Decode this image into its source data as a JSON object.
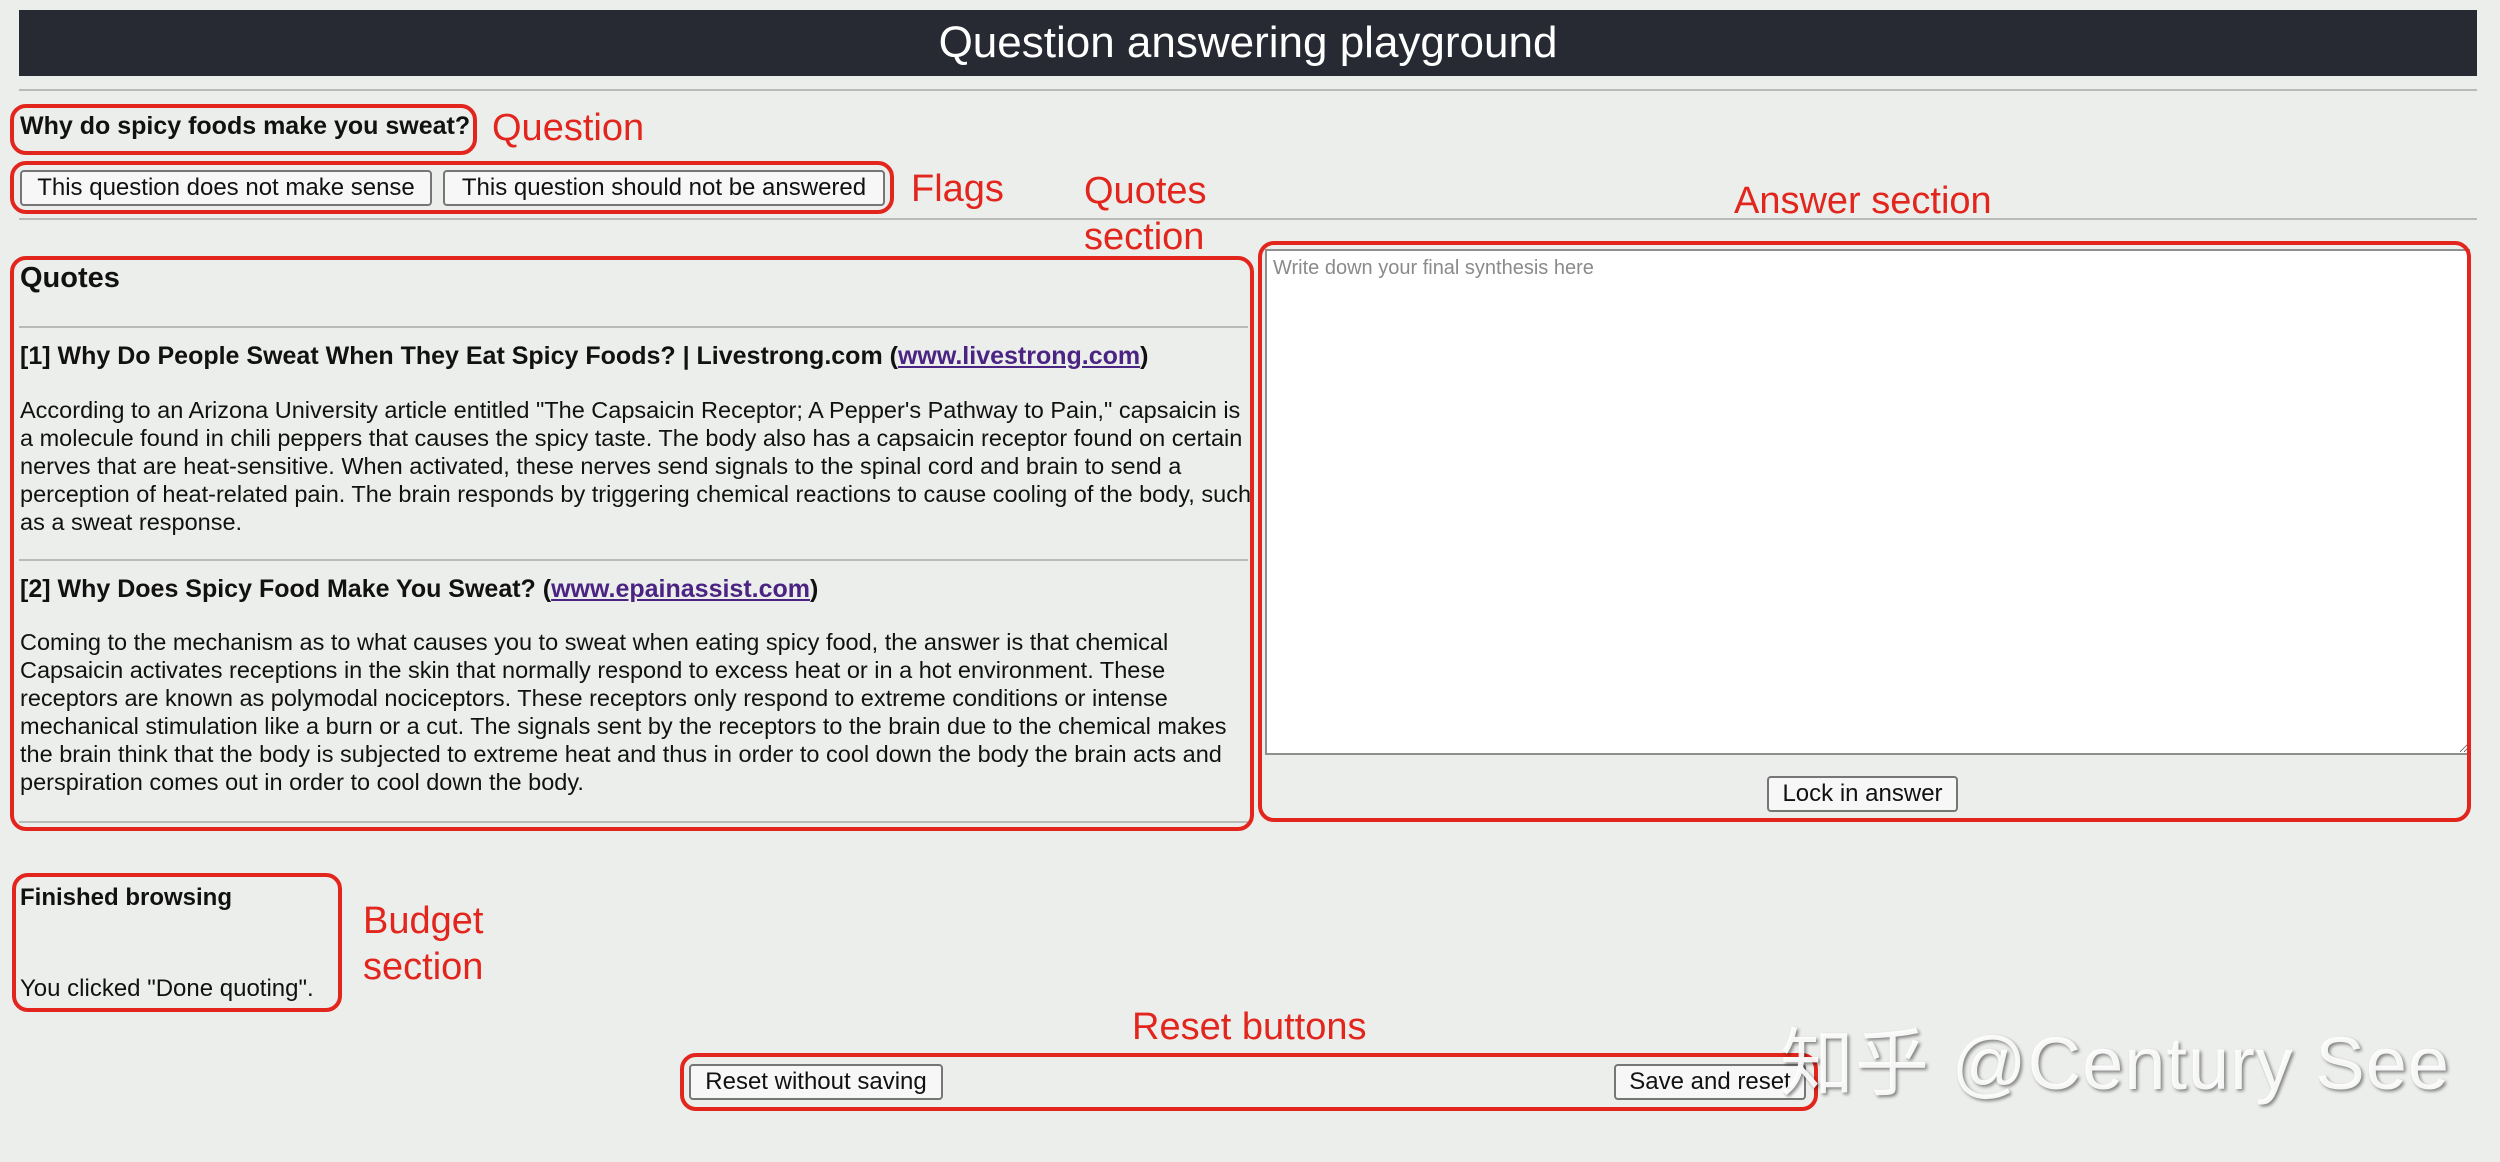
{
  "header": {
    "title": "Question answering playground"
  },
  "question": {
    "text": "Why do spicy foods make you sweat?"
  },
  "flags": {
    "not_make_sense_label": "This question does not make sense",
    "not_be_answered_label": "This question should not be answered"
  },
  "quotes": {
    "heading": "Quotes",
    "items": [
      {
        "title_prefix": "[1] Why Do People Sweat When They Eat Spicy Foods? | Livestrong.com (",
        "link": "www.livestrong.com",
        "title_suffix": ")",
        "body": "According to an Arizona University article entitled \"The Capsaicin Receptor; A Pepper's Pathway to Pain,\" capsaicin is a molecule found in chili peppers that causes the spicy taste. The body also has a capsaicin receptor found on certain nerves that are heat-sensitive. When activated, these nerves send signals to the spinal cord and brain to send a perception of heat-related pain. The brain responds by triggering chemical reactions to cause cooling of the body, such as a sweat response."
      },
      {
        "title_prefix": "[2] Why Does Spicy Food Make You Sweat? (",
        "link": "www.epainassist.com",
        "title_suffix": ")",
        "body": "Coming to the mechanism as to what causes you to sweat when eating spicy food, the answer is that chemical Capsaicin activates receptions in the skin that normally respond to excess heat or in a hot environment. These receptors are known as polymodal nociceptors. These receptors only respond to extreme conditions or intense mechanical stimulation like a burn or a cut. The signals sent by the receptors to the brain due to the chemical makes the brain think that the body is subjected to extreme heat and thus in order to cool down the body the brain acts and perspiration comes out in order to cool down the body."
      }
    ]
  },
  "answer": {
    "placeholder": "Write down your final synthesis here",
    "value": "",
    "lock_label": "Lock in answer"
  },
  "budget": {
    "heading": "Finished browsing",
    "status": "You clicked \"Done quoting\"."
  },
  "reset": {
    "without_saving_label": "Reset without saving",
    "save_and_reset_label": "Save and reset"
  },
  "annotations": {
    "question": "Question",
    "flags": "Flags",
    "quotes_line1": "Quotes",
    "quotes_line2": "section",
    "answer": "Answer section",
    "budget_line1": "Budget",
    "budget_line2": "section",
    "reset": "Reset buttons",
    "color": "#e2251d"
  },
  "watermark": {
    "text": "知乎 @Century See"
  },
  "colors": {
    "header_bg": "#272a33",
    "page_bg": "#eceeeb",
    "link": "#4b2383"
  }
}
